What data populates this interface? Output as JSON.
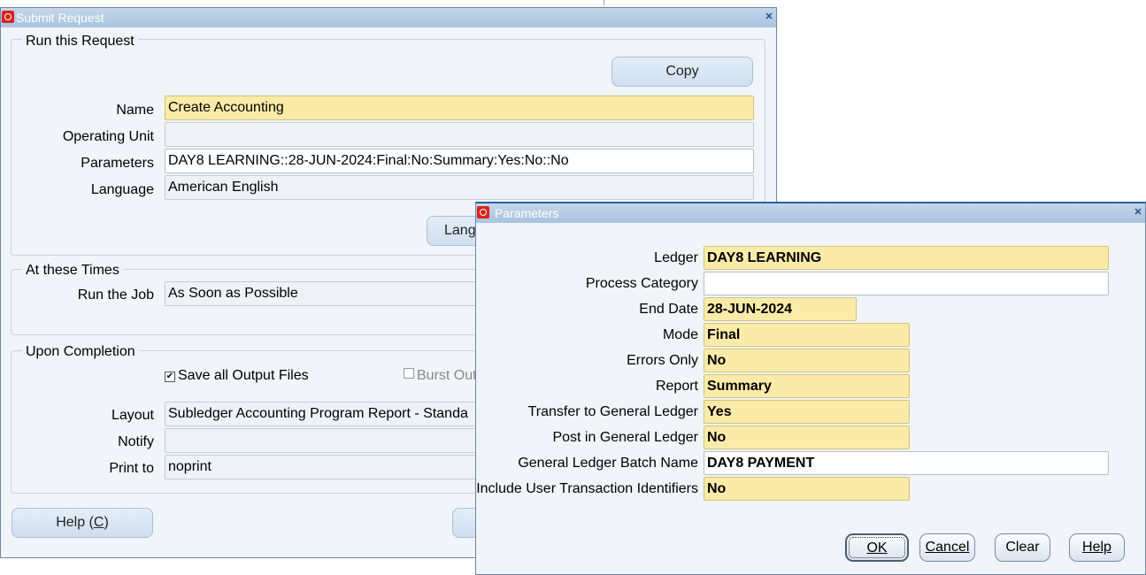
{
  "submit_request": {
    "title": "Submit Request",
    "run_group": {
      "title": "Run this Request",
      "copy_label": "Copy",
      "name_label": "Name",
      "name_value": "Create Accounting",
      "ou_label": "Operating Unit",
      "ou_value": "",
      "params_label": "Parameters",
      "params_value": "DAY8 LEARNING::28-JUN-2024:Final:No:Summary:Yes:No::No",
      "lang_label": "Language",
      "lang_value": "American English",
      "lang_button_partial": "Lang"
    },
    "times_group": {
      "title": "At these Times",
      "runjob_label": "Run the Job",
      "runjob_value": "As Soon as Possible"
    },
    "completion_group": {
      "title": "Upon Completion",
      "save_outputs_label": "Save all Output Files",
      "burst_partial": "Burst Out",
      "layout_label": "Layout",
      "layout_value": "Subledger Accounting Program Report - Standa",
      "notify_label": "Notify",
      "notify_value": "",
      "printto_label": "Print to",
      "printto_value": "noprint"
    },
    "help_prefix": "Help (",
    "help_key": "C",
    "help_suffix": ")"
  },
  "parameters": {
    "title": "Parameters",
    "fields": [
      {
        "label": "Ledger",
        "value": "DAY8 LEARNING"
      },
      {
        "label": "Process Category",
        "value": ""
      },
      {
        "label": "End Date",
        "value": "28-JUN-2024"
      },
      {
        "label": "Mode",
        "value": "Final"
      },
      {
        "label": "Errors Only",
        "value": "No"
      },
      {
        "label": "Report",
        "value": "Summary"
      },
      {
        "label": "Transfer to General Ledger",
        "value": "Yes"
      },
      {
        "label": "Post in General Ledger",
        "value": "No"
      },
      {
        "label": "General Ledger Batch Name",
        "value": "DAY8 PAYMENT"
      },
      {
        "label": "Include User Transaction Identifiers",
        "value": "No"
      }
    ],
    "buttons": {
      "ok": "OK",
      "cancel": "Cancel",
      "clear": "Clear",
      "help": "Help"
    }
  }
}
